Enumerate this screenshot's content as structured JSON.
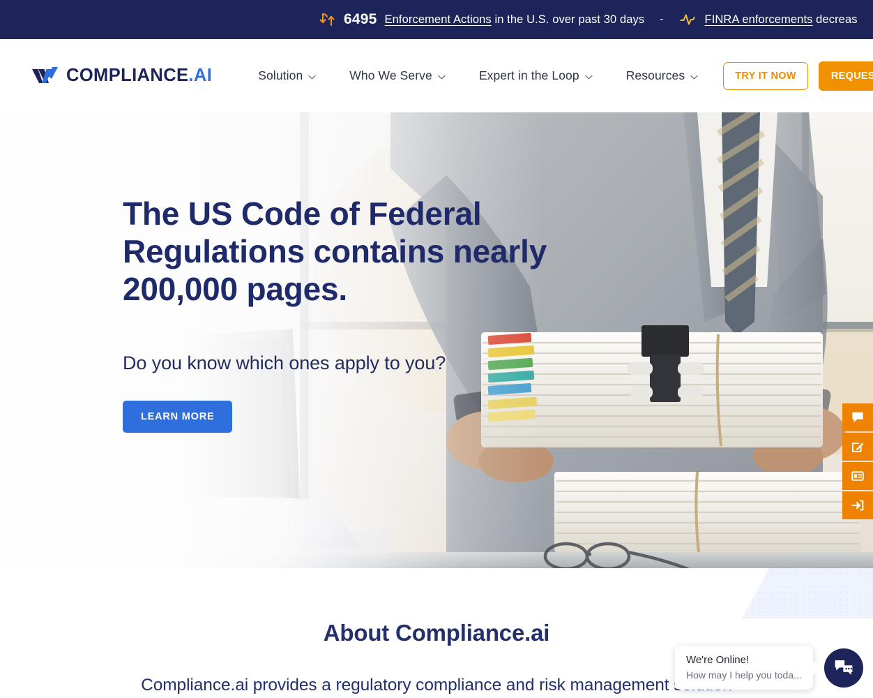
{
  "ticker": {
    "items": [
      {
        "icon": "updown-arrows-icon",
        "number": "6495",
        "link_text": "Enforcement Actions",
        "rest_text": " in the U.S. over past 30 days"
      },
      {
        "icon": "pulse-line-icon",
        "number": "",
        "link_text": "FINRA enforcements",
        "rest_text": " decreas"
      }
    ],
    "separator": "-",
    "bg_color": "#1c2459",
    "accent_color": "#f2911a"
  },
  "header": {
    "logo": {
      "name": "COMPLIANCE",
      "dot": ".",
      "suffix": "AI"
    },
    "nav": [
      {
        "label": "Solution",
        "has_caret": true
      },
      {
        "label": "Who We Serve",
        "has_caret": true
      },
      {
        "label": "Expert in the Loop",
        "has_caret": true
      },
      {
        "label": "Resources",
        "has_caret": true
      }
    ],
    "try_it_now": "TRY IT NOW",
    "request_demo": "REQUEST DEMO",
    "outline_color": "#f08c00",
    "solid_color": "#f29100"
  },
  "hero": {
    "title_part1": "The US Code of Federal Regulations contains nearly 200,000 pages.",
    "subtitle": "Do you know which ones apply to you?",
    "cta": "LEARN MORE",
    "cta_color": "#2f6fdd",
    "title_color": "#1f2a6b"
  },
  "rail": {
    "buttons": [
      {
        "icon": "chat-bubble-icon",
        "name": "feedback"
      },
      {
        "icon": "pencil-edit-icon",
        "name": "edit"
      },
      {
        "icon": "form-card-icon",
        "name": "form"
      },
      {
        "icon": "login-arrow-icon",
        "name": "login"
      }
    ],
    "color": "#ef8200"
  },
  "about": {
    "title": "About Compliance.ai",
    "body": "Compliance.ai provides a regulatory compliance and risk management solution",
    "deco_color": "#eef3fd"
  },
  "chat": {
    "line1": "We're Online!",
    "line2": "How may I help you toda...",
    "fab_icon": "chat-bubbles-icon",
    "fab_color": "#1c2459"
  }
}
